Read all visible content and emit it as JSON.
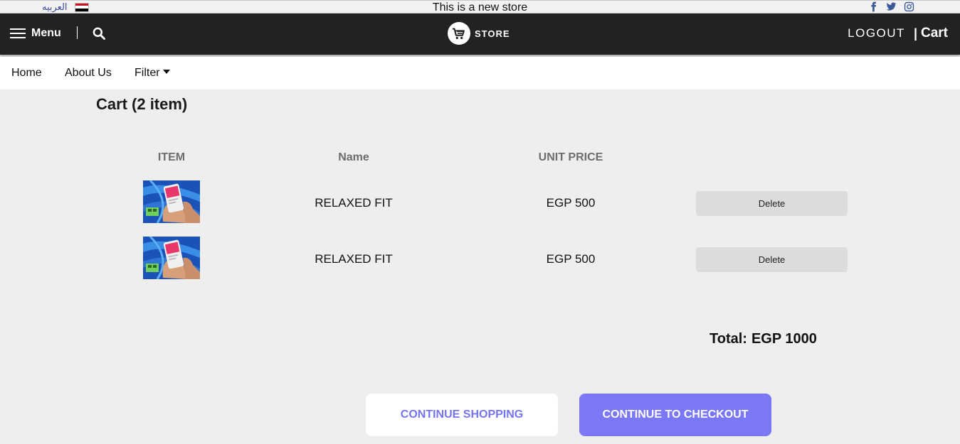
{
  "topbar": {
    "language_label": "العربيه",
    "announcement": "This is a new store",
    "socials": [
      "facebook-icon",
      "twitter-icon",
      "instagram-icon"
    ]
  },
  "header": {
    "menu_label": "Menu",
    "logo_text": "STORE",
    "logout_label": "LOGOUT",
    "cart_separator": "|",
    "cart_label": "Cart"
  },
  "subnav": {
    "home": "Home",
    "about": "About Us",
    "filter": "Filter"
  },
  "cart": {
    "title": "Cart",
    "count_text": "(2 item)",
    "columns": {
      "item": "ITEM",
      "name": "Name",
      "unit_price": "UNIT PRICE"
    },
    "rows": [
      {
        "name": "RELAXED FIT",
        "price": "EGP 500",
        "action": "Delete"
      },
      {
        "name": "RELAXED FIT",
        "price": "EGP 500",
        "action": "Delete"
      }
    ],
    "total_label": "Total:",
    "total_value": "EGP 1000"
  },
  "actions": {
    "continue_shopping": "CONTINUE SHOPPING",
    "checkout": "CONTINUE TO CHECKOUT"
  },
  "colors": {
    "header_bg": "#222222",
    "page_bg": "#eeeeee",
    "accent": "#7b78f6",
    "link_text": "#3a4a9a",
    "social_blue": "#3b5998"
  }
}
